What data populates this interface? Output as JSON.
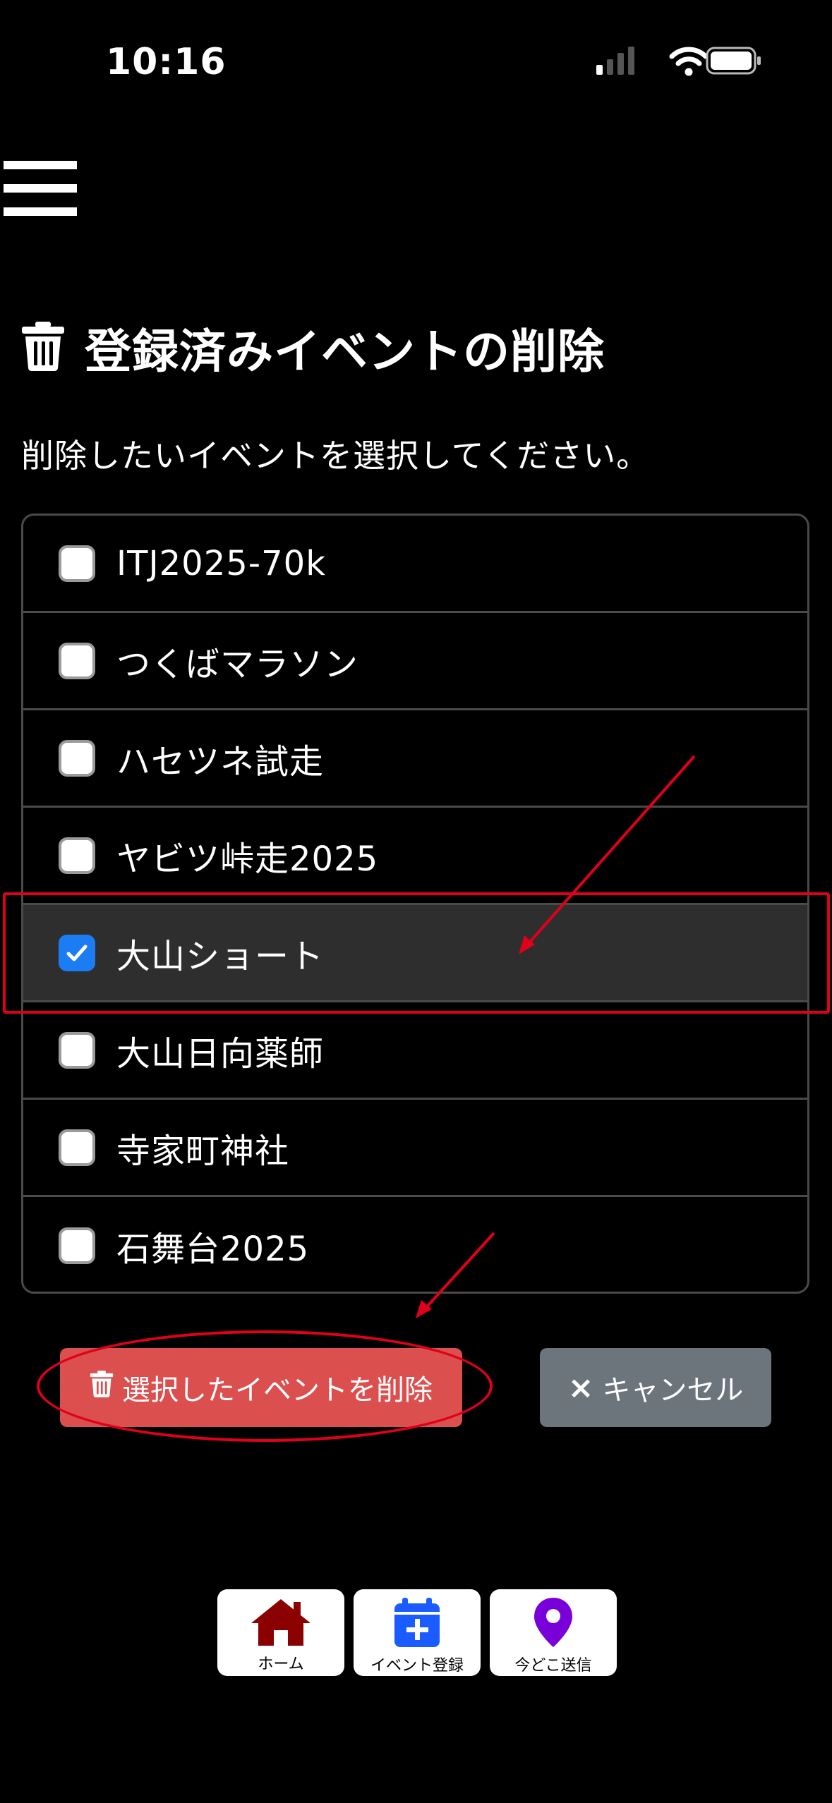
{
  "status_bar": {
    "time": "10:16"
  },
  "page": {
    "title": "登録済みイベントの削除",
    "instruction": "削除したいイベントを選択してください。"
  },
  "events": [
    {
      "label": "ITJ2025-70k",
      "checked": false
    },
    {
      "label": "つくばマラソン",
      "checked": false
    },
    {
      "label": "ハセツネ試走",
      "checked": false
    },
    {
      "label": "ヤビツ峠走2025",
      "checked": false
    },
    {
      "label": "大山ショート",
      "checked": true
    },
    {
      "label": "大山日向薬師",
      "checked": false
    },
    {
      "label": "寺家町神社",
      "checked": false
    },
    {
      "label": "石舞台2025",
      "checked": false
    }
  ],
  "actions": {
    "delete_label": "選択したイベントを削除",
    "cancel_label": "キャンセル",
    "cancel_icon": "×"
  },
  "bottom_nav": {
    "home": "ホーム",
    "register": "イベント登録",
    "send_location": "今どこ送信"
  },
  "colors": {
    "background": "#000000",
    "checkbox_checked": "#1c7cf4",
    "delete_button": "#db4f4f",
    "cancel_button": "#6c747c",
    "annotation_red": "#e0001a",
    "home_icon": "#8b0000",
    "calendar_icon": "#1a5cff",
    "pin_icon": "#7a00d9"
  },
  "icons": {
    "menu": "hamburger-menu-icon",
    "title": "trash-icon",
    "delete": "trash-icon",
    "cancel": "close-icon",
    "home": "home-icon",
    "register": "calendar-plus-icon",
    "send_location": "map-pin-icon"
  }
}
